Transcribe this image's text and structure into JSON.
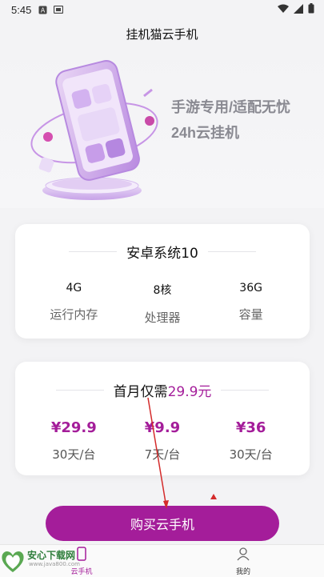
{
  "status_bar": {
    "time": "5:45",
    "icons_left": [
      "a-icon",
      "notification-icon"
    ],
    "icons_right": [
      "wifi-icon",
      "signal-icon",
      "battery-icon"
    ]
  },
  "header": {
    "title": "挂机猫云手机"
  },
  "hero": {
    "line1": "手游专用/适配无忧",
    "line2": "24h云挂机"
  },
  "spec_card": {
    "title": "安卓系统10",
    "items": [
      {
        "value": "4G",
        "label": "运行内存"
      },
      {
        "value": "8核",
        "label": "处理器"
      },
      {
        "value": "36G",
        "label": "容量"
      }
    ]
  },
  "price_card": {
    "title_prefix": "首月仅需",
    "title_price": "29.9元",
    "plans": [
      {
        "price": "¥29.9",
        "label": "30天/台"
      },
      {
        "price": "¥9.9",
        "label": "7天/台"
      },
      {
        "price": "¥36",
        "label": "30天/台"
      }
    ]
  },
  "buy_button": {
    "label": "购买云手机"
  },
  "bottom_nav": {
    "items": [
      {
        "label": "云手机",
        "icon": "phone-icon"
      },
      {
        "label": "我的",
        "icon": "user-icon"
      }
    ]
  },
  "watermark": {
    "text": "安心下载网",
    "url": "www.java800.com"
  },
  "colors": {
    "accent": "#a41d9a",
    "background": "#f3f3f5",
    "card": "#ffffff"
  }
}
